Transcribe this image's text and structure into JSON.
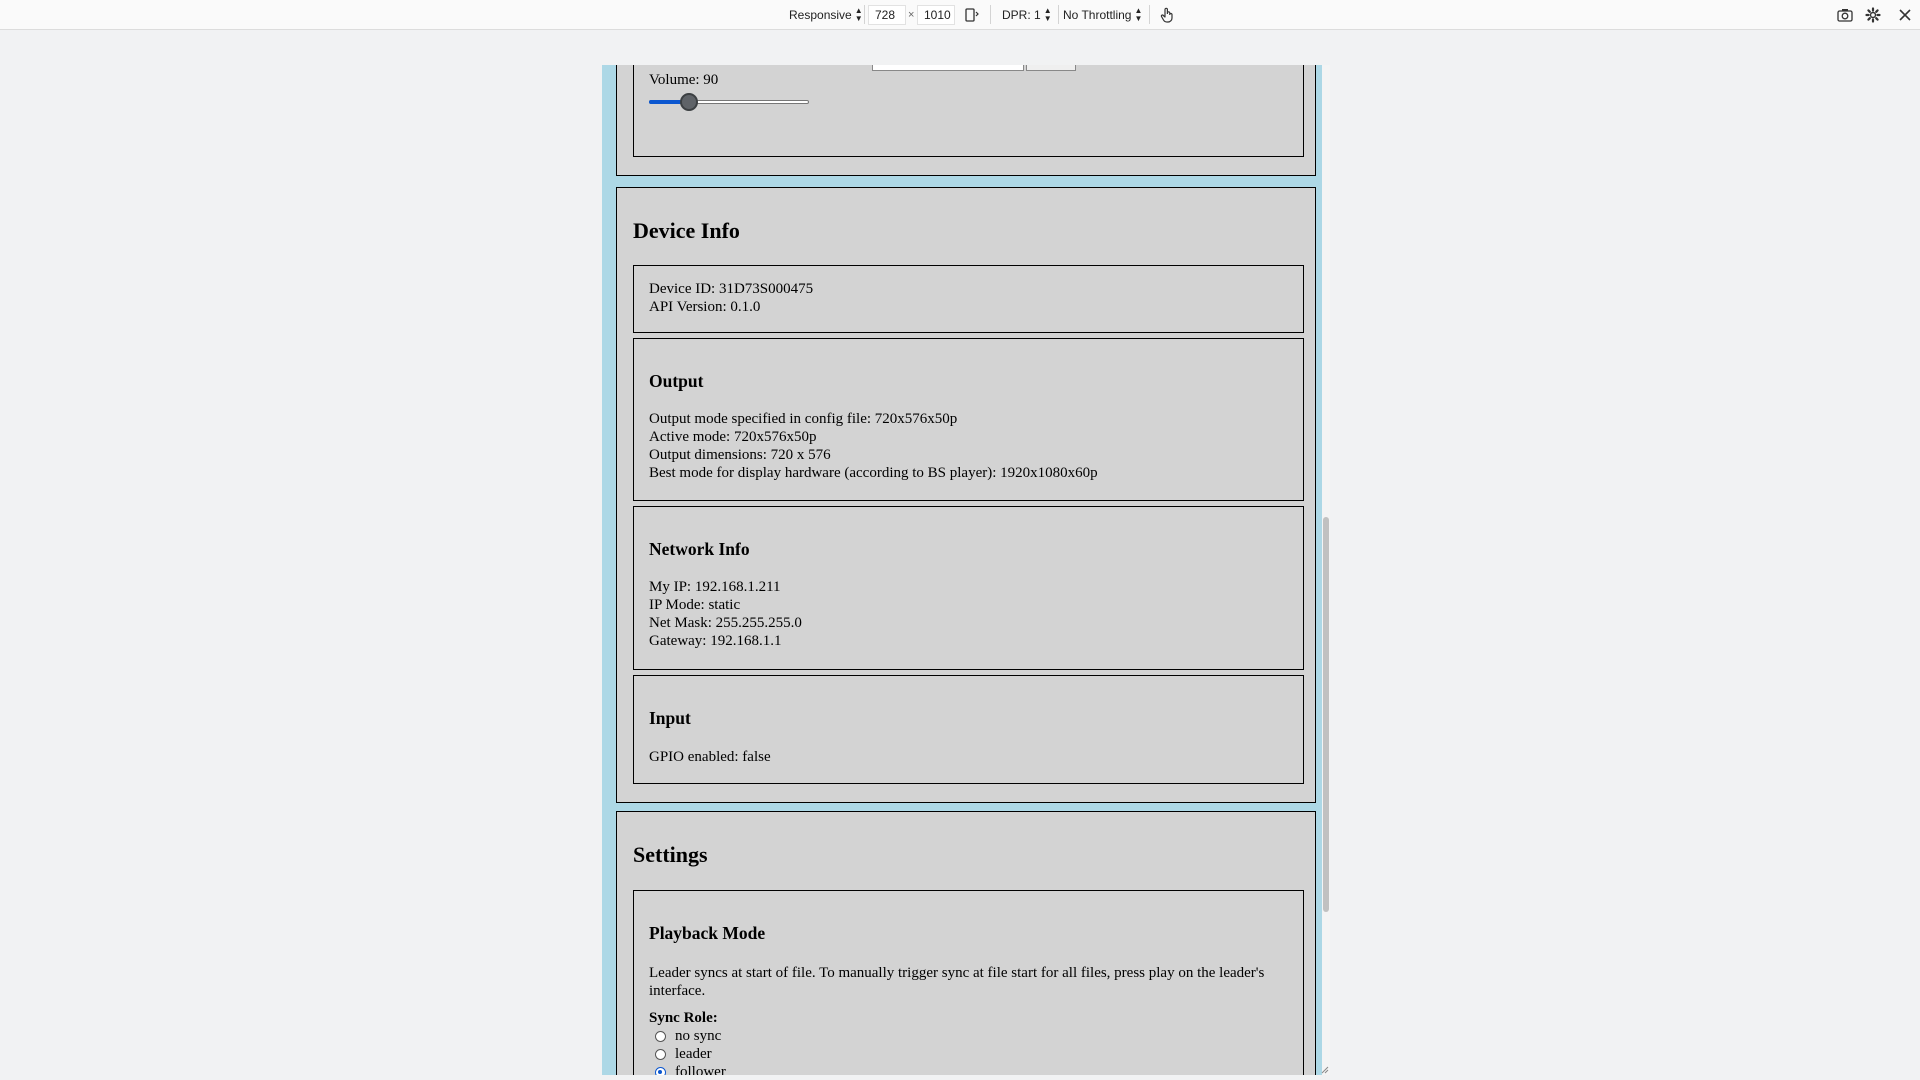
{
  "toolbar": {
    "device": "Responsive",
    "width": "728",
    "times": "×",
    "height": "1010",
    "dpr": "DPR: 1",
    "throttling": "No Throttling"
  },
  "volume": {
    "label": "Volume: 90",
    "slider_fraction": 0.22
  },
  "device_info": {
    "title": "Device Info",
    "general": [
      "Device ID: 31D73S000475",
      "API Version: 0.1.0"
    ],
    "output": {
      "title": "Output",
      "lines": [
        "Output mode specified in config file: 720x576x50p",
        "Active mode: 720x576x50p",
        "Output dimensions: 720 x 576",
        "Best mode for display hardware (according to BS player): 1920x1080x60p"
      ]
    },
    "network": {
      "title": "Network Info",
      "lines": [
        "My IP: 192.168.1.211",
        "IP Mode: static",
        "Net Mask: 255.255.255.0",
        "Gateway: 192.168.1.1"
      ]
    },
    "input": {
      "title": "Input",
      "lines": [
        "GPIO enabled: false"
      ]
    }
  },
  "settings": {
    "title": "Settings",
    "playback": {
      "title": "Playback Mode",
      "description": "Leader syncs at start of file. To manually trigger sync at file start for all files, press play on the leader's interface.",
      "sync_role_label": "Sync Role:",
      "options": [
        "no sync",
        "leader",
        "follower"
      ],
      "selected_index": 2
    }
  }
}
